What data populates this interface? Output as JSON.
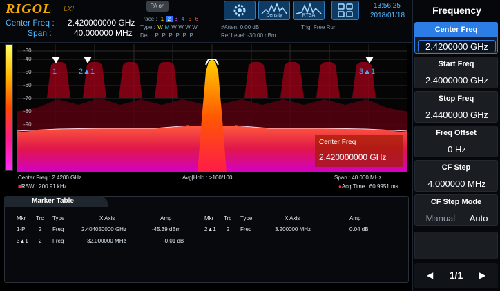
{
  "header": {
    "logo": "RIGOL",
    "logo_sub": "LXI",
    "pa_button": "PA on",
    "center_freq_label": "Center Freq :",
    "center_freq_value": "2.420000000 GHz",
    "span_label": "Span :",
    "span_value": "40.000000 MHz",
    "trace_row_label": "Trace :",
    "type_row_label": "Type :",
    "det_row_label": "Det :",
    "trace_numbers": [
      "1",
      "2",
      "3",
      "4",
      "5",
      "6"
    ],
    "trace_types": [
      "W",
      "M",
      "W",
      "W",
      "W",
      "W"
    ],
    "trace_dets": [
      "P",
      "P",
      "P",
      "P",
      "P",
      "P"
    ],
    "atten": "#Atten: 0.00 dB",
    "ref_level": "Ref Level: -30.00 dBm",
    "trig": "Trig: Free Run",
    "mode_buttons": [
      {
        "icon": "gear-icon",
        "label": ""
      },
      {
        "icon": "density-icon",
        "label": "Density"
      },
      {
        "icon": "rtsa-icon",
        "label": "RTSA"
      },
      {
        "icon": "grid-layout-icon",
        "label": ""
      }
    ],
    "time": "13:56:25",
    "date": "2018/01/18"
  },
  "menu": {
    "title": "Frequency",
    "keys": [
      {
        "label": "Center Freq",
        "value": "2.4200000 GHz",
        "active": true
      },
      {
        "label": "Start Freq",
        "value": "2.4000000 GHz"
      },
      {
        "label": "Stop Freq",
        "value": "2.4400000 GHz"
      },
      {
        "label": "Freq Offset",
        "value": "0 Hz"
      },
      {
        "label": "CF Step",
        "value": "4.000000 MHz"
      },
      {
        "label": "CF Step Mode",
        "option_left": "Manual",
        "option_right": "Auto"
      }
    ],
    "page": "1/1"
  },
  "display": {
    "y_ticks": [
      "-30",
      "-40",
      "-50",
      "-60",
      "-70",
      "-80",
      "-90"
    ],
    "markers": [
      "1",
      "2▲1",
      "3▲1"
    ],
    "callout_label": "Center Freq",
    "callout_value": "2.420000000 GHz",
    "colors": {
      "accent": "#2d7de6",
      "trace": "#ff3a00",
      "logo": "#f2a900"
    }
  },
  "status": {
    "center_freq": "Center Freq : 2.4200 GHz",
    "rbw": "RBW : 200.91 kHz",
    "avg_hold": "Avg|Hold : >100/100",
    "span": "Span : 40.000 MHz",
    "acq_time": "Acq Time : 60.9951 ms"
  },
  "marker_table": {
    "title": "Marker Table",
    "headers": [
      "Mkr",
      "Trc",
      "Type",
      "X Axis",
      "Amp"
    ],
    "left_rows": [
      [
        "1-P",
        "2",
        "Freq",
        "2.404050000 GHz",
        "-45.39 dBm"
      ],
      [
        "3▲1",
        "2",
        "Freq",
        "32.000000 MHz",
        "-0.01 dB"
      ]
    ],
    "right_rows": [
      [
        "2▲1",
        "2",
        "Freq",
        "3.200000 MHz",
        "0.04 dB"
      ]
    ]
  }
}
